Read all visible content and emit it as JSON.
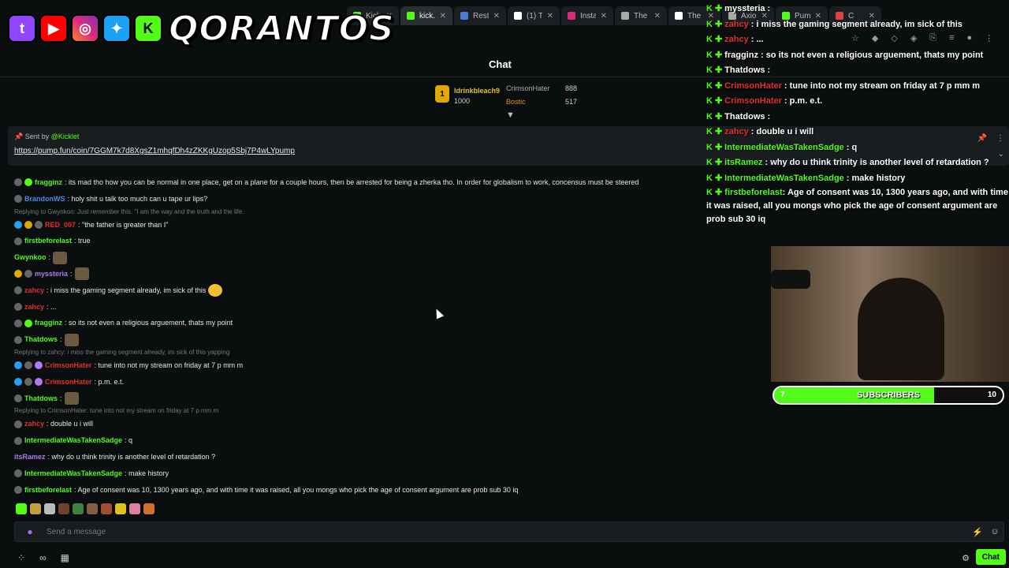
{
  "browser": {
    "tabs": [
      {
        "label": "Kick",
        "color": "#53fc18",
        "active": false
      },
      {
        "label": "kick.c",
        "color": "#53fc18",
        "active": true
      },
      {
        "label": "Rest",
        "color": "#4a7bd0",
        "active": false
      },
      {
        "label": "(1) Ti",
        "color": "#ffffff",
        "active": false
      },
      {
        "label": "Insta",
        "color": "#dd2a7b",
        "active": false
      },
      {
        "label": "The I",
        "color": "#aaaaaa",
        "active": false
      },
      {
        "label": "The I",
        "color": "#ffffff",
        "active": false
      },
      {
        "label": "Axio",
        "color": "#aaaaaa",
        "active": false
      },
      {
        "label": "Pum",
        "color": "#53fc18",
        "active": false
      },
      {
        "label": "C",
        "color": "#e04040",
        "active": false
      }
    ]
  },
  "overlay": {
    "brand": "QORANTOS"
  },
  "header": {
    "title": "Chat"
  },
  "leaderboard": {
    "first_rank": "1",
    "first_name": "ldrinkbleach9",
    "first_value": "1000",
    "second_name": "CrimsonHater",
    "second_value": "888",
    "third_name": "Bostic",
    "third_value": "517"
  },
  "pinned": {
    "sent_by_prefix": "Sent by",
    "sent_by_user": "@Kicklet",
    "link": "https://pump.fun/coin/7GGM7k7d8XgsZ1mhqfDh4zZKKgUzop5Sbj7P4wLYpump"
  },
  "messages": [
    {
      "user": "fragginz",
      "color": "#53fc18",
      "text": ": its mad tho how you can be normal in one place, get on a plane for a couple hours, then be arrested for being a zherka tho. In order for globalism to work, concensus must be steered",
      "badges": [
        "#666666",
        "#53fc18"
      ]
    },
    {
      "user": "BrandonWS",
      "color": "#4a8be0",
      "text": ": holy shit u talk too much can u tape ur lips?",
      "badges": [
        "#666666"
      ]
    },
    {
      "reply": "Replying to Gwynkoo: Just remember this. \"I am the way and the truth and the life."
    },
    {
      "user": "RED_007",
      "color": "#e03030",
      "text": ": \"the father is greater than I\"",
      "badges": [
        "#2a9df4",
        "#e0a800",
        "#666666"
      ]
    },
    {
      "user": "firstbeforelast",
      "color": "#53fc18",
      "text": ": true",
      "badges": [
        "#666666"
      ]
    },
    {
      "user": "Gwynkoo",
      "color": "#53fc18",
      "text": ":",
      "badges": [],
      "emote": true
    },
    {
      "user": "myssteria",
      "color": "#b07af0",
      "text": ":",
      "badges": [
        "#e0a800",
        "#666666"
      ],
      "emote": true
    },
    {
      "user": "zahcy",
      "color": "#e03030",
      "text": ": i miss the gaming segment already, im sick of this",
      "badges": [
        "#666666"
      ],
      "emote_round": true
    },
    {
      "user": "zahcy",
      "color": "#e03030",
      "text": ": ...",
      "badges": [
        "#666666"
      ]
    },
    {
      "user": "fragginz",
      "color": "#53fc18",
      "text": ": so its not even a religious arguement, thats my point",
      "badges": [
        "#666666",
        "#53fc18"
      ]
    },
    {
      "user": "Thatdows",
      "color": "#53fc18",
      "text": ":",
      "badges": [
        "#666666"
      ],
      "emote": true
    },
    {
      "reply": "Replying to zahcy: i miss the gaming segment already, im sick of this yapping"
    },
    {
      "user": "CrimsonHater",
      "color": "#e03030",
      "text": ": tune into not my stream on friday at 7 p mm m",
      "badges": [
        "#2a9df4",
        "#666666",
        "#b07af0"
      ]
    },
    {
      "user": "CrimsonHater",
      "color": "#e03030",
      "text": ": p.m. e.t.",
      "badges": [
        "#2a9df4",
        "#666666",
        "#b07af0"
      ]
    },
    {
      "user": "Thatdows",
      "color": "#53fc18",
      "text": ":",
      "badges": [
        "#666666"
      ],
      "emote": true
    },
    {
      "reply": "Replying to CrimsonHater: tune into not my stream on friday at 7 p mm m"
    },
    {
      "user": "zahcy",
      "color": "#e03030",
      "text": ": double u i will",
      "badges": [
        "#666666"
      ]
    },
    {
      "user": "IntermediateWasTakenSadge",
      "color": "#53fc18",
      "text": ": q",
      "badges": [
        "#666666"
      ]
    },
    {
      "user": "itsRamez",
      "color": "#b07af0",
      "text": ": why do u think trinity is another level of retardation ?",
      "badges": []
    },
    {
      "user": "IntermediateWasTakenSadge",
      "color": "#53fc18",
      "text": ": make history",
      "badges": [
        "#666666"
      ]
    },
    {
      "user": "firstbeforelast",
      "color": "#53fc18",
      "text": ": Age of consent was 10, 1300 years ago, and with time it was raised, all you mongs who pick the age of consent argument are prob sub 30 iq",
      "badges": [
        "#666666"
      ]
    }
  ],
  "input": {
    "placeholder": "Send a message"
  },
  "bottom": {
    "chat_button": "Chat"
  },
  "overlay_chat": [
    {
      "user": "myssteria",
      "color": "#ffffff",
      "text": ":"
    },
    {
      "user": "zahcy",
      "color": "#e03030",
      "text": ": i miss the gaming segment already, im sick of this"
    },
    {
      "user": "zahcy",
      "color": "#e03030",
      "text": ": ..."
    },
    {
      "user": "fragginz",
      "color": "#ffffff",
      "text": ": so its not even a religious arguement, thats my point"
    },
    {
      "user": "Thatdows",
      "color": "#ffffff",
      "text": ":"
    },
    {
      "user": "CrimsonHater",
      "color": "#e03030",
      "text": ": tune into not my stream on friday at 7 p mm m"
    },
    {
      "user": "CrimsonHater",
      "color": "#e03030",
      "text": ": p.m. e.t."
    },
    {
      "user": "Thatdows",
      "color": "#ffffff",
      "text": ":"
    },
    {
      "user": "zahcy",
      "color": "#e03030",
      "text": ": double u i will"
    },
    {
      "user": "IntermediateWasTakenSadge",
      "color": "#53fc18",
      "text": ": q"
    },
    {
      "user": "itsRamez",
      "color": "#53fc18",
      "text": ": why do u think trinity is another level of retardation ?"
    },
    {
      "user": "IntermediateWasTakenSadge",
      "color": "#53fc18",
      "text": ": make history"
    }
  ],
  "overlay_chat_last": {
    "user": "firstbeforelast",
    "text": ": Age of consent was 10, 1300 years ago, and with time it was raised, all you mongs who pick the age of consent argument are prob sub 30 iq"
  },
  "subscribers": {
    "label": "SUBSCRIBERS",
    "current": "7",
    "goal": "10",
    "progress": 0.7
  },
  "colors": {
    "accent": "#53fc18",
    "background": "#0b0e0f"
  }
}
